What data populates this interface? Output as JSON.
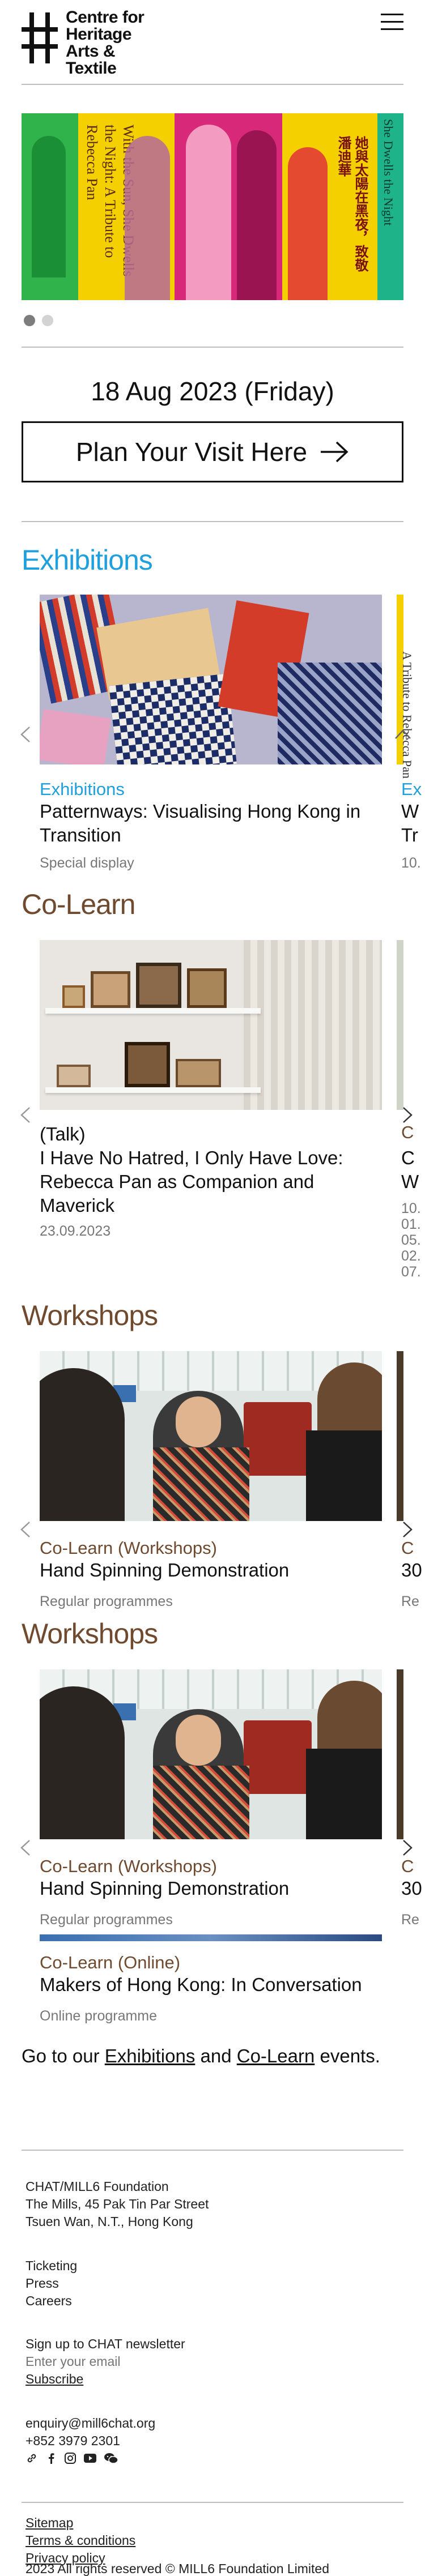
{
  "header": {
    "logo_text": "Centre for\nHeritage\nArts &\nTextile"
  },
  "hero": {
    "slides": [
      {
        "text_en": "With the Sun, She Dwells the Night: A Tribute to Rebecca Pan",
        "text_zh": "她與太陽在黑夜，致敬潘迪華"
      },
      {
        "text_en": "She Dwells the Night"
      }
    ],
    "dots": 2
  },
  "visit": {
    "date": "18 Aug 2023 (Friday)",
    "button_label": "Plan Your Visit Here"
  },
  "exhibitions": {
    "title": "Exhibitions",
    "cards": [
      {
        "category": "Exhibitions",
        "title": "Patternways: Visualising Hong Kong in Transition",
        "meta": "Special display"
      },
      {
        "category": "Ex",
        "title_l1": "W",
        "title_l2": "Tr",
        "meta": "10.",
        "side_text": "A Tribute to Rebecca Pan"
      }
    ]
  },
  "colearn": {
    "title": "Co-Learn",
    "cards": [
      {
        "category": "(Talk)",
        "title": "I Have No Hatred, I Only Have Love: Rebecca Pan as Companion and Maverick",
        "meta": "23.09.2023"
      },
      {
        "category": "C",
        "title_l1": "C",
        "title_l2": "W",
        "meta_lines": [
          "10.",
          "01.",
          "05.",
          "02.",
          "07."
        ]
      }
    ]
  },
  "workshops_1": {
    "title": "Workshops",
    "cards": [
      {
        "category": "Co-Learn (Workshops)",
        "title": "Hand Spinning Demonstration",
        "meta": "Regular programmes"
      },
      {
        "category": "C",
        "title": "30",
        "meta": "Re"
      }
    ]
  },
  "workshops_2": {
    "title": "Workshops",
    "cards": [
      {
        "category": "Co-Learn (Workshops)",
        "title": "Hand Spinning Demonstration",
        "meta": "Regular programmes"
      },
      {
        "category": "C",
        "title": "30",
        "meta": "Re"
      }
    ],
    "online_card": {
      "category": "Co-Learn (Online)",
      "title": "Makers of Hong Kong: In Conversation",
      "meta": "Online programme"
    }
  },
  "goto": {
    "prefix": "Go to our",
    "exhibitions_link": "Exhibitions",
    "and": "and",
    "colearn_link": "Co-Learn",
    "suffix": "events."
  },
  "footer": {
    "org": "CHAT/MILL6 Foundation",
    "address1": "The Mills, 45 Pak Tin Par Street",
    "address2": "Tsuen Wan, N.T., Hong Kong",
    "links": [
      "Ticketing",
      "Press",
      "Careers"
    ],
    "newsletter_label": "Sign up to CHAT newsletter",
    "email_placeholder": "Enter your email",
    "subscribe": "Subscribe",
    "email": "enquiry@mill6chat.org",
    "phone": "+852 3979 2301",
    "social_icons": [
      "link-icon",
      "facebook-icon",
      "instagram-icon",
      "youtube-icon",
      "wechat-icon"
    ],
    "sitemap": "Sitemap",
    "terms": "Terms & conditions",
    "privacy": "Privacy policy",
    "copyright": "2023 All rights reserved © MILL6 Foundation Limited"
  },
  "colors": {
    "exhibitions_blue": "#1fa0dc",
    "colearn_brown": "#6f4a2f",
    "hero_green": "#2fb34a",
    "hero_yellow": "#f4d000",
    "hero_magenta": "#d8287a"
  }
}
